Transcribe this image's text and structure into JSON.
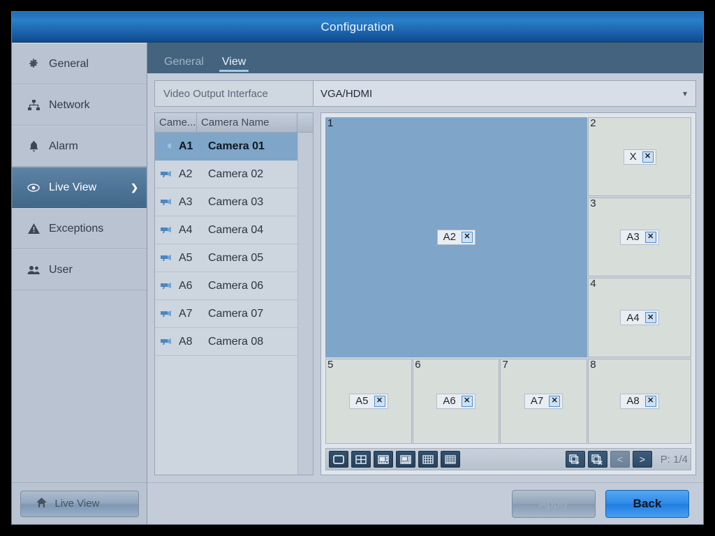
{
  "window": {
    "title": "Configuration"
  },
  "sidebar": {
    "items": [
      {
        "label": "General",
        "icon": "gear-icon",
        "active": false
      },
      {
        "label": "Network",
        "icon": "network-icon",
        "active": false
      },
      {
        "label": "Alarm",
        "icon": "bell-icon",
        "active": false
      },
      {
        "label": "Live View",
        "icon": "eye-icon",
        "active": true
      },
      {
        "label": "Exceptions",
        "icon": "warning-icon",
        "active": false
      },
      {
        "label": "User",
        "icon": "users-icon",
        "active": false
      }
    ],
    "bottom_button": {
      "label": "Live View",
      "icon": "home-icon"
    }
  },
  "tabs": [
    {
      "label": "General",
      "active": false
    },
    {
      "label": "View",
      "active": true
    }
  ],
  "output_interface": {
    "label": "Video Output Interface",
    "value": "VGA/HDMI",
    "caret": "chevron-down-icon"
  },
  "camera_list": {
    "columns": [
      "Came...",
      "Camera Name"
    ],
    "rows": [
      {
        "id": "A1",
        "name": "Camera 01",
        "selected": true
      },
      {
        "id": "A2",
        "name": "Camera 02",
        "selected": false
      },
      {
        "id": "A3",
        "name": "Camera 03",
        "selected": false
      },
      {
        "id": "A4",
        "name": "Camera 04",
        "selected": false
      },
      {
        "id": "A5",
        "name": "Camera 05",
        "selected": false
      },
      {
        "id": "A6",
        "name": "Camera 06",
        "selected": false
      },
      {
        "id": "A7",
        "name": "Camera 07",
        "selected": false
      },
      {
        "id": "A8",
        "name": "Camera 08",
        "selected": false
      }
    ]
  },
  "layout_preview": {
    "panes": [
      {
        "num": "1",
        "tag": "A2",
        "filled": true,
        "close": "x"
      },
      {
        "num": "2",
        "tag": "X",
        "filled": false,
        "close": "x"
      },
      {
        "num": "3",
        "tag": "A3",
        "filled": false,
        "close": "x"
      },
      {
        "num": "4",
        "tag": "A4",
        "filled": false,
        "close": "x"
      },
      {
        "num": "5",
        "tag": "A5",
        "filled": false,
        "close": "x"
      },
      {
        "num": "6",
        "tag": "A6",
        "filled": false,
        "close": "x"
      },
      {
        "num": "7",
        "tag": "A7",
        "filled": false,
        "close": "x"
      },
      {
        "num": "8",
        "tag": "A8",
        "filled": false,
        "close": "x"
      }
    ]
  },
  "toolbar": {
    "layout_buttons": [
      {
        "name": "layout-1x1-button",
        "mode": "1x1"
      },
      {
        "name": "layout-2x2-button",
        "mode": "2x2"
      },
      {
        "name": "layout-1p5-button",
        "mode": "1+5"
      },
      {
        "name": "layout-1p7-button",
        "mode": "1+7"
      },
      {
        "name": "layout-3x3-button",
        "mode": "3x3"
      },
      {
        "name": "layout-4x4-button",
        "mode": "4x4"
      }
    ],
    "apply_layout_button": "apply-layout-icon",
    "clear_layout_button": "clear-layout-icon",
    "prev_page_button": "<",
    "next_page_button": ">",
    "page_label": "P: 1/4"
  },
  "footer": {
    "apply_label": "Apply",
    "back_label": "Back"
  },
  "colors": {
    "titlebar_blue": "#1f6cb6",
    "accent_blue": "#2f8ae8",
    "selected_row": "#7fa5c8",
    "panel_bg": "#c3ccd8",
    "tabbar_bg": "#44637f"
  }
}
